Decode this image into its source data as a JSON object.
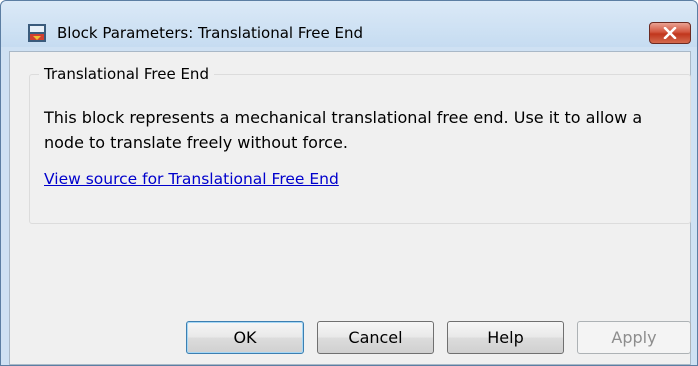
{
  "window": {
    "title": "Block Parameters: Translational Free End",
    "app_icon": "simulink-block-icon",
    "close_icon": "close-x-icon",
    "accent_close": "#c8432a",
    "titlebar_color": "#cfe1f3"
  },
  "group": {
    "title": "Translational Free End",
    "description": "This block represents a mechanical translational free end. Use it to allow a node to translate freely without force.",
    "link_text": "View source for Translational Free End",
    "link_color": "#0000cc"
  },
  "buttons": {
    "ok": "OK",
    "cancel": "Cancel",
    "help": "Help",
    "apply": "Apply"
  }
}
